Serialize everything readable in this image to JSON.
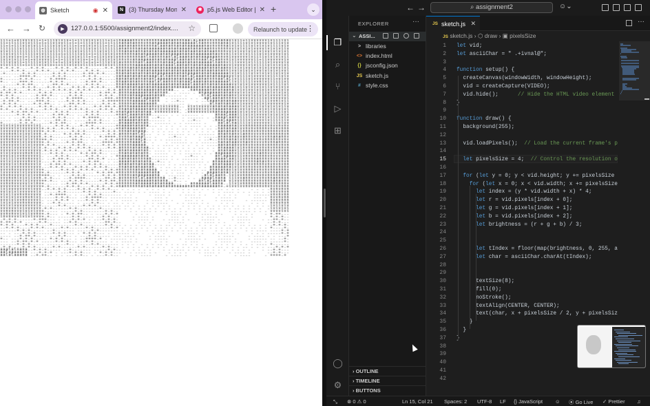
{
  "browser": {
    "tabs": [
      {
        "title": "Sketch",
        "icon": "globe-icon",
        "recording": true,
        "active": true
      },
      {
        "title": "(3) Thursday Mon",
        "icon": "notion-icon",
        "active": false
      },
      {
        "title": "p5.js Web Editor |",
        "icon": "p5-asterisk-icon",
        "active": false
      }
    ],
    "new_tab_label": "+",
    "url": "127.0.0.1:5500/assignment2/index....",
    "relaunch_label": "Relaunch to update",
    "accent": "#d9c6ef"
  },
  "vscode": {
    "search": "assignment2",
    "explorer_title": "EXPLORER",
    "folder": "ASSI...",
    "files": [
      {
        "name": "libraries",
        "icon": "chevron-right-icon",
        "glyph": ">",
        "color": "#cccccc"
      },
      {
        "name": "index.html",
        "icon": "html-icon",
        "glyph": "<>",
        "color": "#e37933"
      },
      {
        "name": "jsconfig.json",
        "icon": "json-icon",
        "glyph": "{}",
        "color": "#cbcb41"
      },
      {
        "name": "sketch.js",
        "icon": "js-icon",
        "glyph": "JS",
        "color": "#e6c94e"
      },
      {
        "name": "style.css",
        "icon": "css-icon",
        "glyph": "#",
        "color": "#519aba"
      }
    ],
    "sections": [
      "OUTLINE",
      "TIMELINE",
      "BUTTONS"
    ],
    "editor_tab": "sketch.js",
    "breadcrumb": [
      "sketch.js",
      "draw",
      "pixelsSize"
    ],
    "current_line": 15,
    "code_lines": [
      "let vid;",
      "let asciiChar = \" .+ivnal@\";",
      "",
      "function setup() {",
      "  createCanvas(windowWidth, windowHeight);",
      "  vid = createCapture(VIDEO);",
      "  vid.hide();      // Hide the HTML video element",
      "}",
      "",
      "function draw() {",
      "  background(255);",
      "",
      "  vid.loadPixels();  // Load the current frame's p",
      "",
      "  let pixelsSize = 4;  // Control the resolution o",
      "",
      "  for (let y = 0; y < vid.height; y += pixelsSize",
      "    for (let x = 0; x < vid.width; x += pixelsSize",
      "      let index = (y * vid.width + x) * 4;",
      "      let r = vid.pixels[index + 0];",
      "      let g = vid.pixels[index + 1];",
      "      let b = vid.pixels[index + 2];",
      "      let brightness = (r + g + b) / 3;",
      "",
      "",
      "      let tIndex = floor(map(brightness, 0, 255, a",
      "      let char = asciiChar.charAt(tIndex);",
      "",
      "",
      "      textSize(8);",
      "      fill(0);",
      "      noStroke();",
      "      textAlign(CENTER, CENTER);",
      "      text(char, x + pixelsSize / 2, y + pixelsSiz",
      "    }",
      "  }",
      "}",
      "",
      "",
      "",
      "",
      ""
    ],
    "status": {
      "errors": "0",
      "warnings": "0",
      "position": "Ln 15, Col 21",
      "spaces": "Spaces: 2",
      "encoding": "UTF-8",
      "eol": "LF",
      "language": "JavaScript",
      "golive": "Go Live",
      "prettier": "Prettier"
    },
    "accent": "#0078d4"
  }
}
